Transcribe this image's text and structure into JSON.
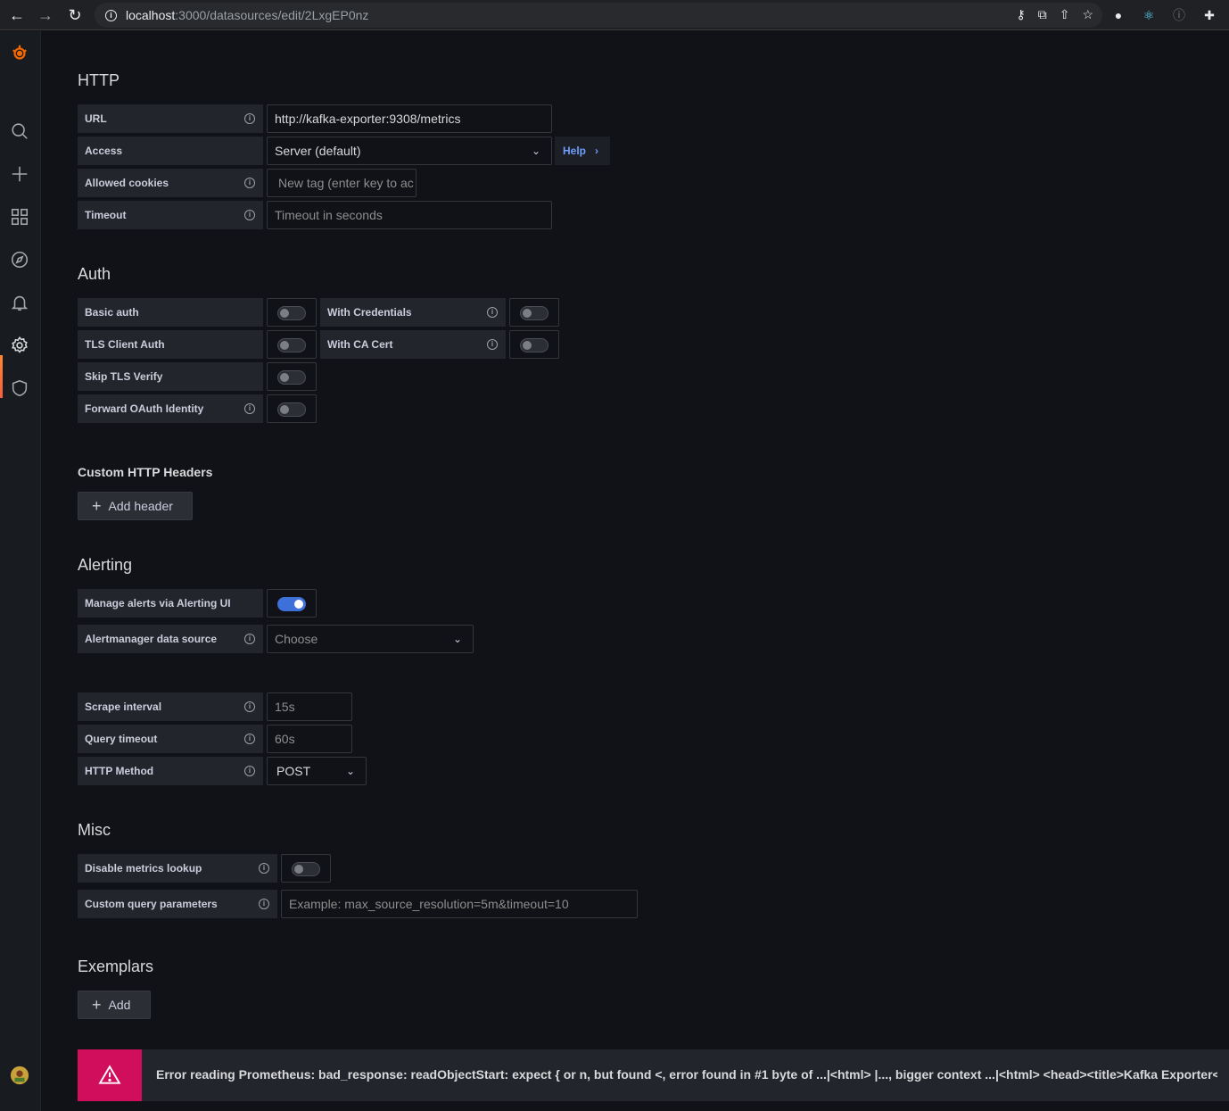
{
  "browser": {
    "url_host": "localhost",
    "url_path": ":3000/datasources/edit/2LxgEP0nz"
  },
  "sections": {
    "http_title": "HTTP",
    "auth_title": "Auth",
    "custom_headers_title": "Custom HTTP Headers",
    "alerting_title": "Alerting",
    "misc_title": "Misc",
    "exemplars_title": "Exemplars"
  },
  "http": {
    "url_label": "URL",
    "url_value": "http://kafka-exporter:9308/metrics",
    "access_label": "Access",
    "access_value": "Server (default)",
    "help_label": "Help",
    "cookies_label": "Allowed cookies",
    "cookies_placeholder": "New tag (enter key to ac",
    "timeout_label": "Timeout",
    "timeout_placeholder": "Timeout in seconds"
  },
  "auth": {
    "basic_auth": "Basic auth",
    "with_credentials": "With Credentials",
    "tls_client_auth": "TLS Client Auth",
    "with_ca_cert": "With CA Cert",
    "skip_tls_verify": "Skip TLS Verify",
    "forward_oauth": "Forward OAuth Identity"
  },
  "headers": {
    "add_header_label": "Add header"
  },
  "alerting": {
    "manage_alerts_label": "Manage alerts via Alerting UI",
    "manage_alerts_on": true,
    "alertmanager_label": "Alertmanager data source",
    "alertmanager_value": "Choose",
    "scrape_interval_label": "Scrape interval",
    "scrape_interval_placeholder": "15s",
    "query_timeout_label": "Query timeout",
    "query_timeout_placeholder": "60s",
    "http_method_label": "HTTP Method",
    "http_method_value": "POST"
  },
  "misc": {
    "disable_metrics_label": "Disable metrics lookup",
    "custom_params_label": "Custom query parameters",
    "custom_params_placeholder": "Example: max_source_resolution=5m&timeout=10"
  },
  "exemplars": {
    "add_label": "Add"
  },
  "error": {
    "message": "Error reading Prometheus: bad_response: readObjectStart: expect { or n, but found <, error found in #1 byte of ...|<html> |..., bigger context ...|<html> <head><title>Kafka Exporter</title>|..."
  },
  "colors": {
    "accent": "#3d71d9",
    "error": "#d10e5c",
    "link": "#6e9fff",
    "brand": "#f46800"
  }
}
